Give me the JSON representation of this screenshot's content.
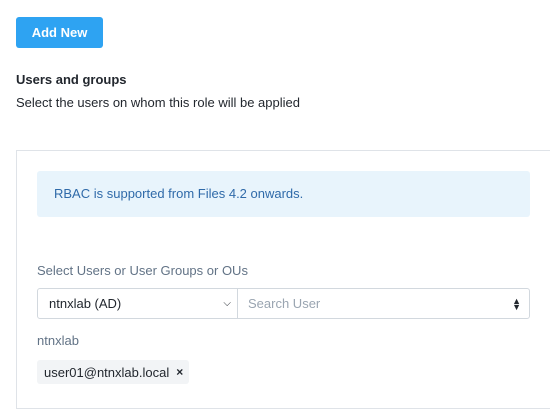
{
  "toolbar": {
    "add_new_label": "Add New"
  },
  "section": {
    "title": "Users and groups",
    "description": "Select the users on whom this role will be applied"
  },
  "panel": {
    "info_message": "RBAC is supported from Files 4.2 onwards.",
    "select_label": "Select Users or User Groups or OUs",
    "domain_select": {
      "value": "ntnxlab (AD)",
      "icon": "chevron-down-icon"
    },
    "search": {
      "placeholder": "Search User",
      "value": "",
      "icon": "up-down-arrows-icon"
    },
    "group_label": "ntnxlab",
    "selected_users": [
      {
        "label": "user01@ntnxlab.local",
        "remove_icon": "close-icon"
      }
    ]
  },
  "colors": {
    "accent": "#2ea3f2",
    "info_bg": "#e8f4fc",
    "info_text": "#2f6aa9",
    "muted_text": "#627386"
  }
}
